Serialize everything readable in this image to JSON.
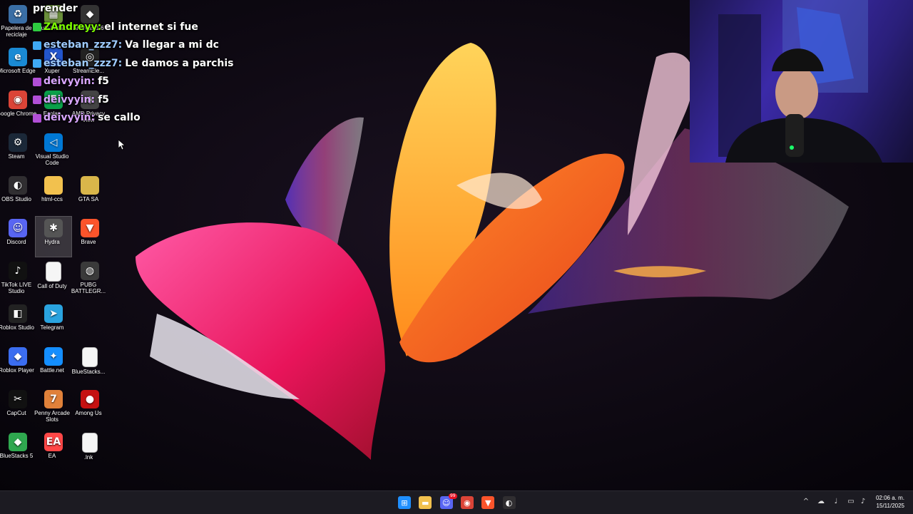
{
  "desktop": {
    "icons": [
      {
        "label": "Papelera de reciclaje",
        "icon": "recycle-bin-icon",
        "color": "#3a6ea5",
        "glyph": "♻"
      },
      {
        "label": "Multi-Insta...",
        "icon": "minecraft-icon",
        "color": "#6a8f3a",
        "glyph": "▦"
      },
      {
        "label": "Andreas 1.6",
        "icon": "game-icon",
        "color": "#333333",
        "glyph": "◆"
      },
      {
        "label": "Microsoft Edge",
        "icon": "edge-icon",
        "color": "#1a8ad4",
        "glyph": "e"
      },
      {
        "label": "Xuper",
        "icon": "xuper-icon",
        "color": "#2255cc",
        "glyph": "X"
      },
      {
        "label": "StreamEle...",
        "icon": "streamelements-icon",
        "color": "#222222",
        "glyph": "◎"
      },
      {
        "label": "Google Chrome",
        "icon": "chrome-icon",
        "color": "#db4437",
        "glyph": "◉"
      },
      {
        "label": "Ecolan",
        "icon": "ecolan-icon",
        "color": "#0aa04a",
        "glyph": "E"
      },
      {
        "label": "AMD Privacy View",
        "icon": "amd-icon",
        "color": "#444444",
        "glyph": "◈"
      },
      {
        "label": "Steam",
        "icon": "steam-icon",
        "color": "#1b2838",
        "glyph": "⚙"
      },
      {
        "label": "Visual Studio Code",
        "icon": "vscode-icon",
        "color": "#0078d4",
        "glyph": "◁"
      },
      {
        "label": "OBS Studio",
        "icon": "obs-icon",
        "color": "#302e31",
        "glyph": "◐"
      },
      {
        "label": "html-ccs",
        "icon": "folder-icon",
        "color": "#f2c14e",
        "glyph": ""
      },
      {
        "label": "GTA SA",
        "icon": "folder-icon",
        "color": "#d9b64a",
        "glyph": ""
      },
      {
        "label": "Discord",
        "icon": "discord-icon",
        "color": "#5865f2",
        "glyph": "☺"
      },
      {
        "label": "Hydra",
        "icon": "hydra-icon",
        "color": "#555555",
        "glyph": "✱"
      },
      {
        "label": "Brave",
        "icon": "brave-icon",
        "color": "#fb542b",
        "glyph": "▼"
      },
      {
        "label": "TikTok LIVE Studio",
        "icon": "tiktok-icon",
        "color": "#111111",
        "glyph": "♪"
      },
      {
        "label": "Call of Duty",
        "icon": "file-icon",
        "color": "#f5f5f5",
        "glyph": ""
      },
      {
        "label": "PUBG BATTLEGR...",
        "icon": "pubg-icon",
        "color": "#3a3a3a",
        "glyph": "◍"
      },
      {
        "label": "Roblox Studio",
        "icon": "roblox-studio-icon",
        "color": "#222222",
        "glyph": "◧"
      },
      {
        "label": "Telegram",
        "icon": "telegram-icon",
        "color": "#2aa3df",
        "glyph": "➤"
      },
      {
        "label": "Roblox Player",
        "icon": "roblox-icon",
        "color": "#3b6df0",
        "glyph": "◆"
      },
      {
        "label": "Battle.net",
        "icon": "battlenet-icon",
        "color": "#148eff",
        "glyph": "✦"
      },
      {
        "label": "BlueStacks...",
        "icon": "file-icon",
        "color": "#f5f5f5",
        "glyph": ""
      },
      {
        "label": "CapCut",
        "icon": "capcut-icon",
        "color": "#111111",
        "glyph": "✂"
      },
      {
        "label": "Penny Arcade Slots",
        "icon": "slots-icon",
        "color": "#e0813a",
        "glyph": "7"
      },
      {
        "label": "Among Us",
        "icon": "among-us-icon",
        "color": "#c51111",
        "glyph": "●"
      },
      {
        "label": "BlueStacks 5",
        "icon": "bluestacks-icon",
        "color": "#2fa84f",
        "glyph": "◆"
      },
      {
        "label": "EA",
        "icon": "ea-icon",
        "color": "#ff4747",
        "glyph": "EA"
      },
      {
        "label": ".lnk",
        "icon": "file-icon",
        "color": "#f5f5f5",
        "glyph": ""
      }
    ]
  },
  "chat": {
    "lines": [
      {
        "user": "",
        "message": "prender",
        "badge_color": ""
      },
      {
        "user": "ZAndreyy:",
        "message": "el internet si fue",
        "badge_color": "#2ecc40",
        "user_color": "#7CFC00"
      },
      {
        "user": "esteban_zzz7:",
        "message": "Va llegar a mi dc",
        "badge_color": "#3fa9f5",
        "user_color": "#9ecbff"
      },
      {
        "user": "esteban_zzz7:",
        "message": "Le damos a parchis",
        "badge_color": "#3fa9f5",
        "user_color": "#9ecbff"
      },
      {
        "user": "deivyyin:",
        "message": "f5",
        "badge_color": "#b14fd6",
        "user_color": "#d9a6ff"
      },
      {
        "user": "deivyyin:",
        "message": "f5",
        "badge_color": "#b14fd6",
        "user_color": "#d9a6ff"
      },
      {
        "user": "deivyyin:",
        "message": "se callo",
        "badge_color": "#b14fd6",
        "user_color": "#d9a6ff"
      }
    ]
  },
  "taskbar": {
    "apps": [
      {
        "name": "windows-start-icon",
        "color": "#1f8fff",
        "glyph": "⊞"
      },
      {
        "name": "file-explorer-icon",
        "color": "#f2c14e",
        "glyph": "▬"
      },
      {
        "name": "discord-icon",
        "color": "#5865f2",
        "glyph": "☺",
        "badge": "99"
      },
      {
        "name": "chrome-icon",
        "color": "#db4437",
        "glyph": "◉"
      },
      {
        "name": "brave-icon",
        "color": "#fb542b",
        "glyph": "▼"
      },
      {
        "name": "obs-icon",
        "color": "#302e31",
        "glyph": "◐"
      }
    ],
    "tray": [
      {
        "name": "show-hidden-icons-chevron",
        "glyph": "^"
      },
      {
        "name": "cloud-icon",
        "glyph": "☁"
      },
      {
        "name": "microphone-icon",
        "glyph": "♩"
      },
      {
        "name": "display-icon",
        "glyph": "▭"
      },
      {
        "name": "volume-icon",
        "glyph": "♪"
      }
    ],
    "time": "02:06 a. m.",
    "date": "15/11/2025"
  }
}
